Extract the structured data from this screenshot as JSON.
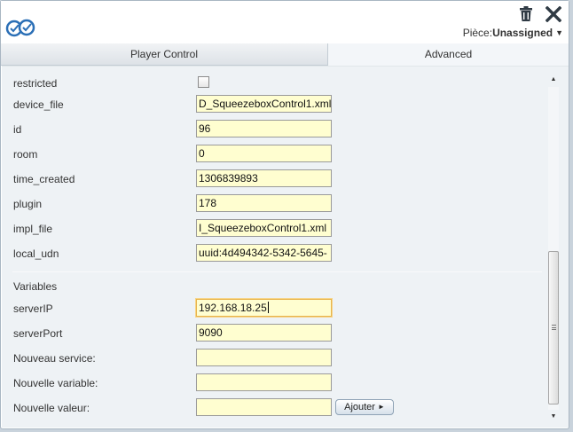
{
  "header": {
    "logo_icon": "vera-logo-icon",
    "room_prefix": "Pièce:",
    "room_value": "Unassigned",
    "delete_icon": "trash-icon",
    "close_icon": "close-icon"
  },
  "tabs": [
    {
      "label": "Player Control",
      "active": false
    },
    {
      "label": "Advanced",
      "active": true
    }
  ],
  "attributes": [
    {
      "label": "restricted",
      "type": "checkbox",
      "checked": false
    },
    {
      "label": "device_file",
      "value": "D_SqueezeboxControl1.xml"
    },
    {
      "label": "id",
      "value": "96"
    },
    {
      "label": "room",
      "value": "0"
    },
    {
      "label": "time_created",
      "value": "1306839893"
    },
    {
      "label": "plugin",
      "value": "178"
    },
    {
      "label": "impl_file",
      "value": "I_SqueezeboxControl1.xml"
    },
    {
      "label": "local_udn",
      "value": "uuid:4d494342-5342-5645-"
    }
  ],
  "variables": {
    "title": "Variables",
    "items": [
      {
        "label": "serverIP",
        "value": "192.168.18.25",
        "focused": true
      },
      {
        "label": "serverPort",
        "value": "9090"
      }
    ]
  },
  "new_entry": {
    "service_label": "Nouveau service:",
    "service_value": "",
    "variable_label": "Nouvelle variable:",
    "variable_value": "",
    "value_label": "Nouvelle valeur:",
    "value_value": "",
    "add_label": "Ajouter"
  },
  "colors": {
    "field_background": "#fffed0",
    "panel_background": "#eef2f5",
    "focus_border": "#e8b34c"
  }
}
